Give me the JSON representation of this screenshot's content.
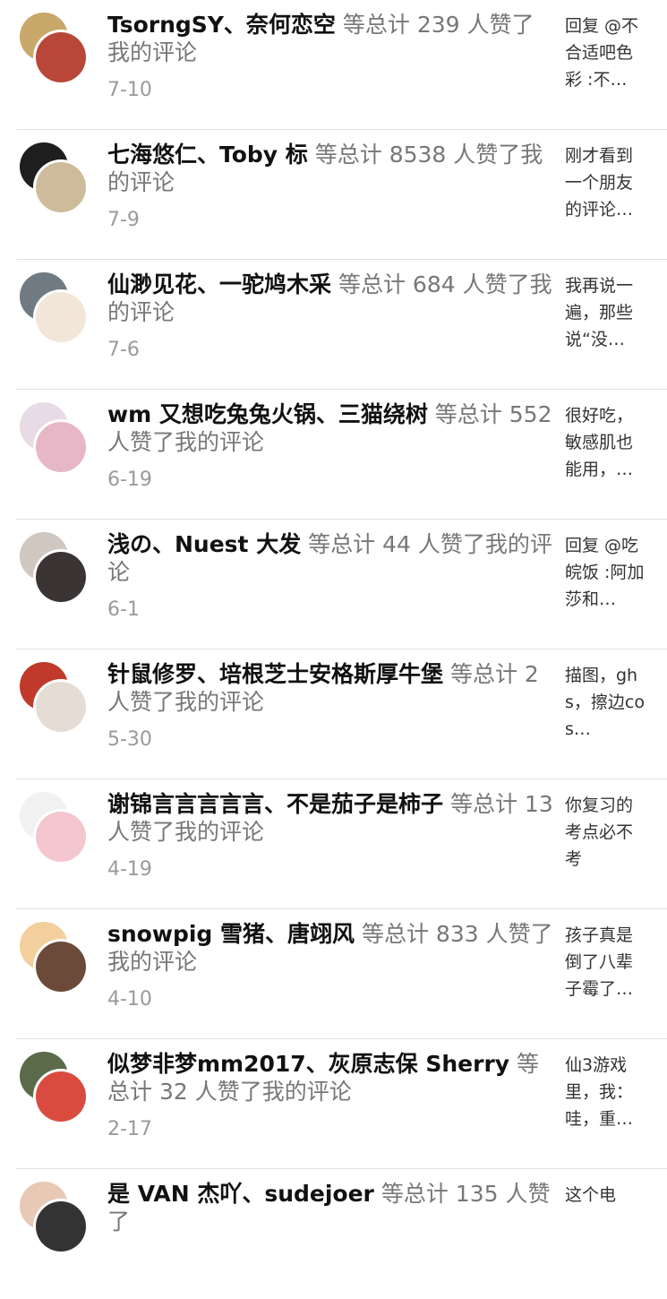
{
  "items": [
    {
      "names": "TsorngSY、奈何恋空",
      "suffix": " 等总计 239 人赞了我的评论",
      "date": "7-10",
      "snippet": "回复 @不合适吧色彩 :不…",
      "avatar_back_color": "#c9a86b",
      "avatar_front_color": "#b8473a"
    },
    {
      "names": "七海悠仁、Toby 标",
      "suffix": " 等总计 8538 人赞了我的评论",
      "date": "7-9",
      "snippet": "刚才看到一个朋友的评论…",
      "avatar_back_color": "#1e1e1e",
      "avatar_front_color": "#cdbb9a"
    },
    {
      "names": "仙渺见花、一驼鸠木采",
      "suffix": " 等总计 684 人赞了我的评论",
      "date": "7-6",
      "snippet": "我再说一遍，那些说“没…",
      "avatar_back_color": "#6f7a82",
      "avatar_front_color": "#f2e6d8"
    },
    {
      "names": "wm 又想吃兔兔火锅、三猫绕树",
      "suffix": " 等总计 552 人赞了我的评论",
      "date": "6-19",
      "snippet": "很好吃，敏感肌也能用，…",
      "avatar_back_color": "#e9dbe6",
      "avatar_front_color": "#e7b7c7"
    },
    {
      "names": "浅の、Nuest 大发",
      "suffix": " 等总计 44 人赞了我的评论",
      "date": "6-1",
      "snippet": "回复 @吃皖饭 :阿加莎和…",
      "avatar_back_color": "#cfc7c0",
      "avatar_front_color": "#3b3434"
    },
    {
      "names": "针鼠修罗、培根芝士安格斯厚牛堡",
      "suffix": " 等总计 2 人赞了我的评论",
      "date": "5-30",
      "snippet": "描图，ghs，擦边cos…",
      "avatar_back_color": "#c0392b",
      "avatar_front_color": "#e6dcd6"
    },
    {
      "names": "谢锦言言言言言、不是茄子是柿子",
      "suffix": " 等总计 13 人赞了我的评论",
      "date": "4-19",
      "snippet": "你复习的考点必不考",
      "avatar_back_color": "#f1f1f1",
      "avatar_front_color": "#f4c6d0"
    },
    {
      "names": "snowpig 雪猪、唐翊风",
      "suffix": " 等总计 833 人赞了我的评论",
      "date": "4-10",
      "snippet": "孩子真是倒了八辈子霉了…",
      "avatar_back_color": "#f3cf9e",
      "avatar_front_color": "#6b4a3a"
    },
    {
      "names": "似梦非梦mm2017、灰原志保 Sherry",
      "suffix": " 等总计 32 人赞了我的评论",
      "date": "2-17",
      "snippet": "仙3游戏里，我：哇，重…",
      "avatar_back_color": "#5b6b4a",
      "avatar_front_color": "#d94b3f"
    },
    {
      "names": "是 VAN 杰吖、sudejoer",
      "suffix": " 等总计 135 人赞了",
      "date": "",
      "snippet": "这个电",
      "avatar_back_color": "#e8c9b5",
      "avatar_front_color": "#333333"
    }
  ]
}
